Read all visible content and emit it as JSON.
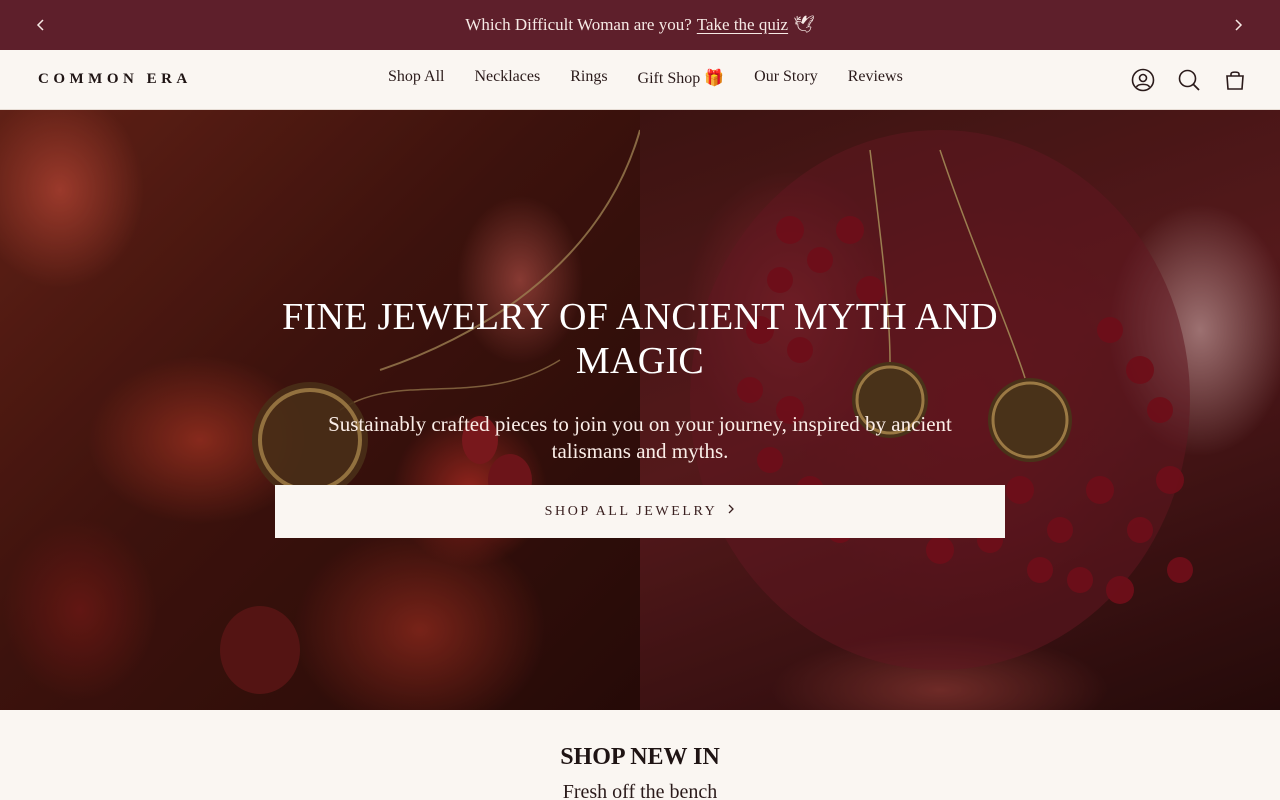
{
  "announcement": {
    "text": "Which Difficult Woman are you?",
    "link": "Take the quiz",
    "emoji": "🕊"
  },
  "header": {
    "logo": "COMMON ERA",
    "nav": [
      "Shop All",
      "Necklaces",
      "Rings",
      "Gift Shop 🎁",
      "Our Story",
      "Reviews"
    ],
    "icons": [
      "account-icon",
      "search-icon",
      "cart-icon"
    ]
  },
  "hero": {
    "title": "FINE JEWELRY OF ANCIENT MYTH AND MAGIC",
    "subtitle": "Sustainably crafted pieces to join you on your journey, inspired by ancient talismans and myths.",
    "button": "SHOP ALL JEWELRY"
  },
  "section": {
    "title": "SHOP NEW IN",
    "subtitle": "Fresh off the bench"
  },
  "colors": {
    "announcement_bg": "#5e1f2b",
    "page_bg": "#faf6f2"
  }
}
